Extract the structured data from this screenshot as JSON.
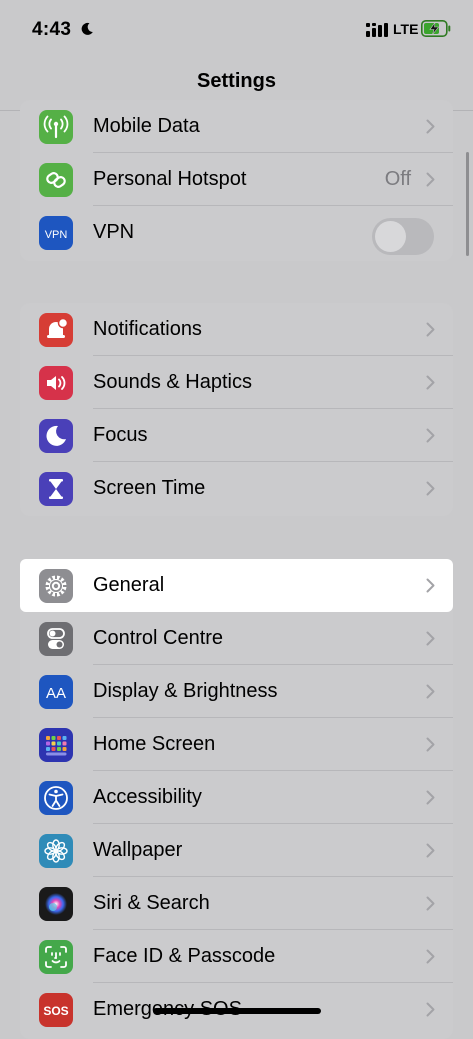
{
  "status_bar": {
    "time": "4:43",
    "network": "LTE"
  },
  "nav": {
    "title": "Settings"
  },
  "group1": [
    {
      "label": "Mobile Data",
      "icon": "antenna-icon",
      "color": "#55b046"
    },
    {
      "label": "Personal Hotspot",
      "value": "Off",
      "icon": "link-icon",
      "color": "#55b046"
    },
    {
      "label": "VPN",
      "icon": "vpn-icon",
      "icon_text": "VPN",
      "color": "#1e56c0",
      "toggle": false
    }
  ],
  "group2": [
    {
      "label": "Notifications",
      "icon": "bell-icon",
      "color": "#d63d35"
    },
    {
      "label": "Sounds & Haptics",
      "icon": "speaker-icon",
      "color": "#d6324a"
    },
    {
      "label": "Focus",
      "icon": "moon-icon",
      "color": "#4a40b8"
    },
    {
      "label": "Screen Time",
      "icon": "hourglass-icon",
      "color": "#4a40b8"
    }
  ],
  "group3": [
    {
      "label": "General",
      "icon": "gear-icon",
      "color": "#8e8e92",
      "selected": true
    },
    {
      "label": "Control Centre",
      "icon": "toggles-icon",
      "color": "#6e6e72"
    },
    {
      "label": "Display & Brightness",
      "icon": "text-size-icon",
      "icon_text": "AA",
      "color": "#1e56c0"
    },
    {
      "label": "Home Screen",
      "icon": "app-grid-icon",
      "color": "#2d34b0"
    },
    {
      "label": "Accessibility",
      "icon": "accessibility-icon",
      "color": "#1e56c0"
    },
    {
      "label": "Wallpaper",
      "icon": "flower-icon",
      "color": "#2f8bb8"
    },
    {
      "label": "Siri & Search",
      "icon": "siri-icon",
      "color": "#1a1a1a"
    },
    {
      "label": "Face ID & Passcode",
      "icon": "face-id-icon",
      "color": "#44a84a"
    },
    {
      "label": "Emergency SOS",
      "icon": "sos-icon",
      "icon_text": "SOS",
      "color": "#c8332c"
    }
  ]
}
